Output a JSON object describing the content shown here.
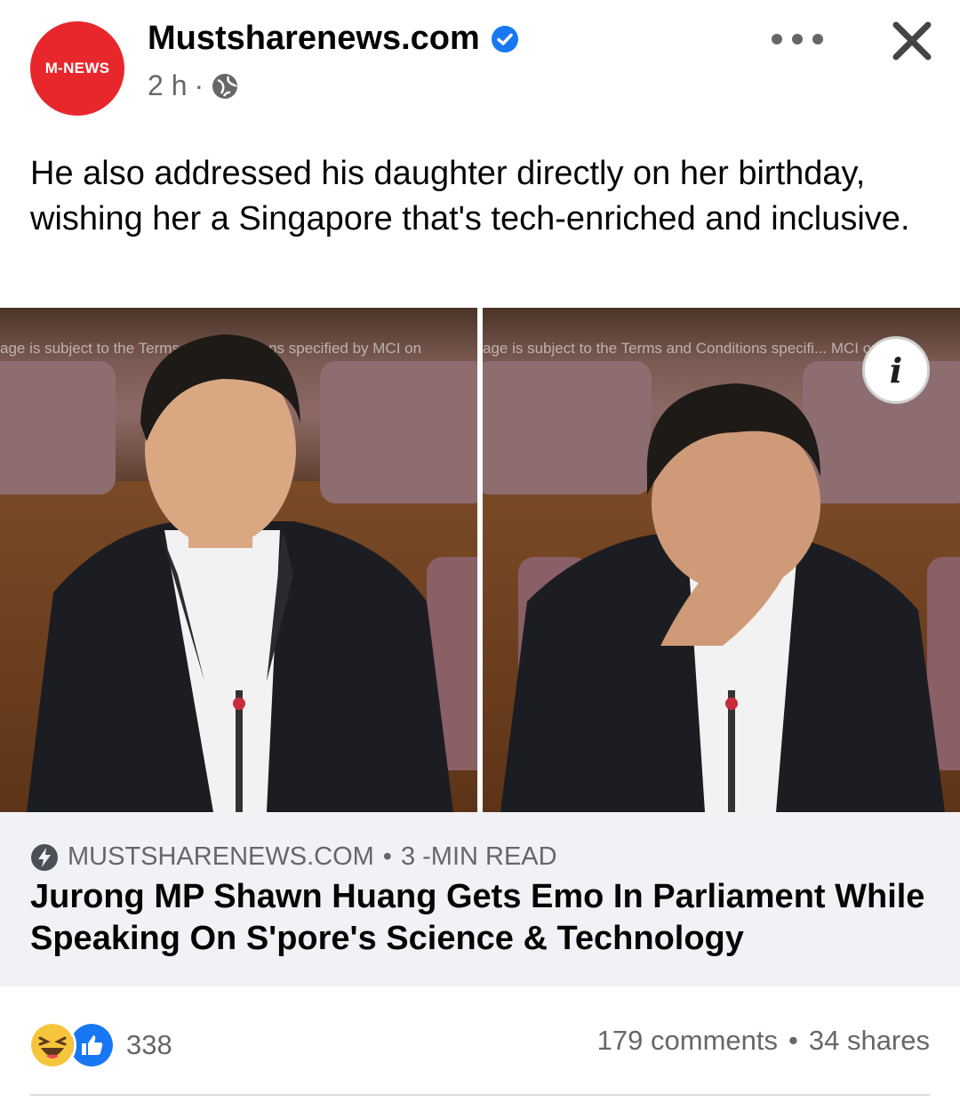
{
  "post": {
    "avatar_text": "M-NEWS",
    "page_name": "Mustsharenews.com",
    "time": "2 h",
    "separator": "·",
    "caption": "He also addressed his daughter directly on her birthday, wishing her a Singapore that's tech-enriched and inclusive."
  },
  "images": {
    "watermark_left": "age is subject to the Terms and Conditions specified by MCI on",
    "watermark_right": "age is subject to the Terms and Conditions specifi... MCI on",
    "info_label": "i"
  },
  "link": {
    "domain": "MUSTSHARENEWS.COM",
    "dot": "•",
    "read_time": "3 -MIN READ",
    "title": "Jurong MP Shawn Huang Gets Emo In Parliament While Speaking On S'pore's Science & Technology"
  },
  "stats": {
    "reaction_count": "338",
    "comments": "179 comments",
    "dot": "•",
    "shares": "34 shares"
  },
  "icons": [
    "verified-badge-icon",
    "globe-icon",
    "more-options-icon",
    "close-icon",
    "info-icon",
    "lightning-bolt-icon",
    "haha-reaction-icon",
    "like-reaction-icon"
  ],
  "colors": {
    "brand_red": "#e8272d",
    "facebook_blue": "#1877f2",
    "secondary_text": "#65676b",
    "card_bg": "#f0f2f5"
  }
}
